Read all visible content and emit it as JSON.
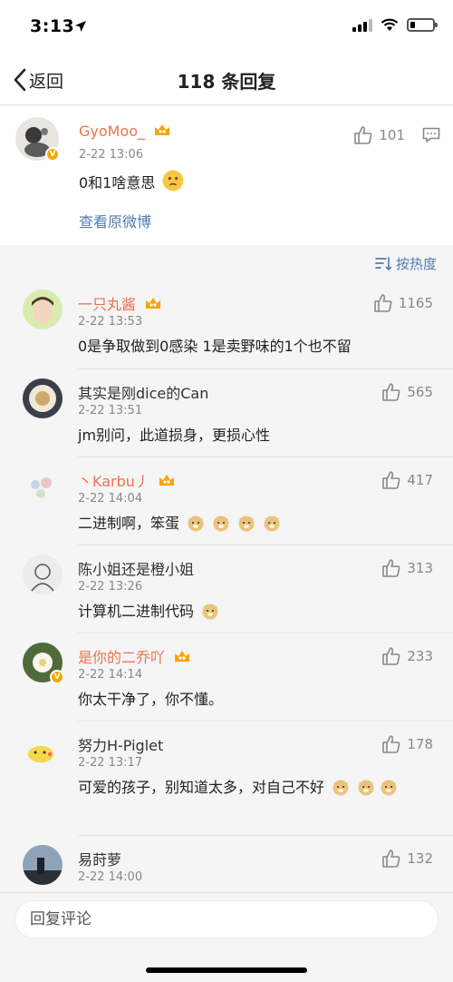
{
  "status": {
    "time": "3:13"
  },
  "nav": {
    "back_label": "返回",
    "title": "118 条回复"
  },
  "original_post": {
    "username": "GyoMoo_",
    "time": "2-22 13:06",
    "text": "0和1啥意思",
    "likes": "101",
    "view_original": "查看原微博"
  },
  "sort_label": "按热度",
  "comments": [
    {
      "username": "一只丸酱",
      "name_color": "orange",
      "vip": true,
      "verified": false,
      "time": "2-22 13:53",
      "text": "0是争取做到0感染 1是卖野味的1个也不留",
      "likes": "1165",
      "emoji_count": 0
    },
    {
      "username": "其实是刚dice的Can",
      "name_color": "dark",
      "vip": false,
      "verified": false,
      "time": "2-22 13:51",
      "text": "jm别问，此道损身，更损心性",
      "likes": "565",
      "emoji_count": 0
    },
    {
      "username": "丶Karbu丿",
      "name_color": "orange",
      "vip": true,
      "verified": false,
      "time": "2-22 14:04",
      "text": "二进制啊，笨蛋",
      "likes": "417",
      "emoji_count": 4
    },
    {
      "username": "陈小姐还是橙小姐",
      "name_color": "dark",
      "vip": false,
      "verified": false,
      "time": "2-22 13:26",
      "text": "计算机二进制代码",
      "likes": "313",
      "emoji_count": 1
    },
    {
      "username": "是你的二乔吖",
      "name_color": "orange",
      "vip": true,
      "verified": true,
      "time": "2-22 14:14",
      "text": "你太干净了，你不懂。",
      "likes": "233",
      "emoji_count": 0
    },
    {
      "username": "努力H-Piglet",
      "name_color": "dark",
      "vip": false,
      "verified": false,
      "time": "2-22 13:17",
      "text": "可爱的孩子，别知道太多，对自己不好",
      "likes": "178",
      "emoji_count": 3
    },
    {
      "username": "易莳萝",
      "name_color": "dark",
      "vip": false,
      "verified": false,
      "time": "2-22 14:00",
      "text": "",
      "likes": "132",
      "emoji_count": 0
    }
  ],
  "reply_placeholder": "回复评论",
  "colors": {
    "accent_orange": "#eb7350",
    "link_blue": "#507daf",
    "vip_gold": "#f7a600"
  }
}
